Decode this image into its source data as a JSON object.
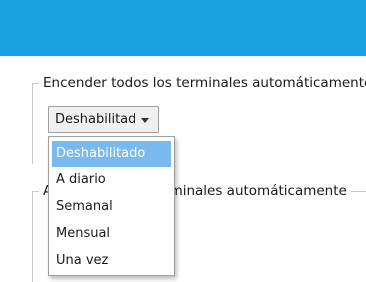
{
  "header": {
    "color": "#1aa1e2"
  },
  "group_on": {
    "legend": "Encender todos los terminales automáticamente",
    "combo": {
      "value": "Deshabilitad",
      "arrow_icon": "chevron-down-icon"
    },
    "dropdown": {
      "options": [
        "Deshabilitado",
        "A diario",
        "Semanal",
        "Mensual",
        "Una vez"
      ],
      "selected_index": 0,
      "selected_color": "#78b9f0"
    }
  },
  "group_off": {
    "legend_prefix": "A",
    "legend_visible_tail": "rminales automáticamente"
  }
}
